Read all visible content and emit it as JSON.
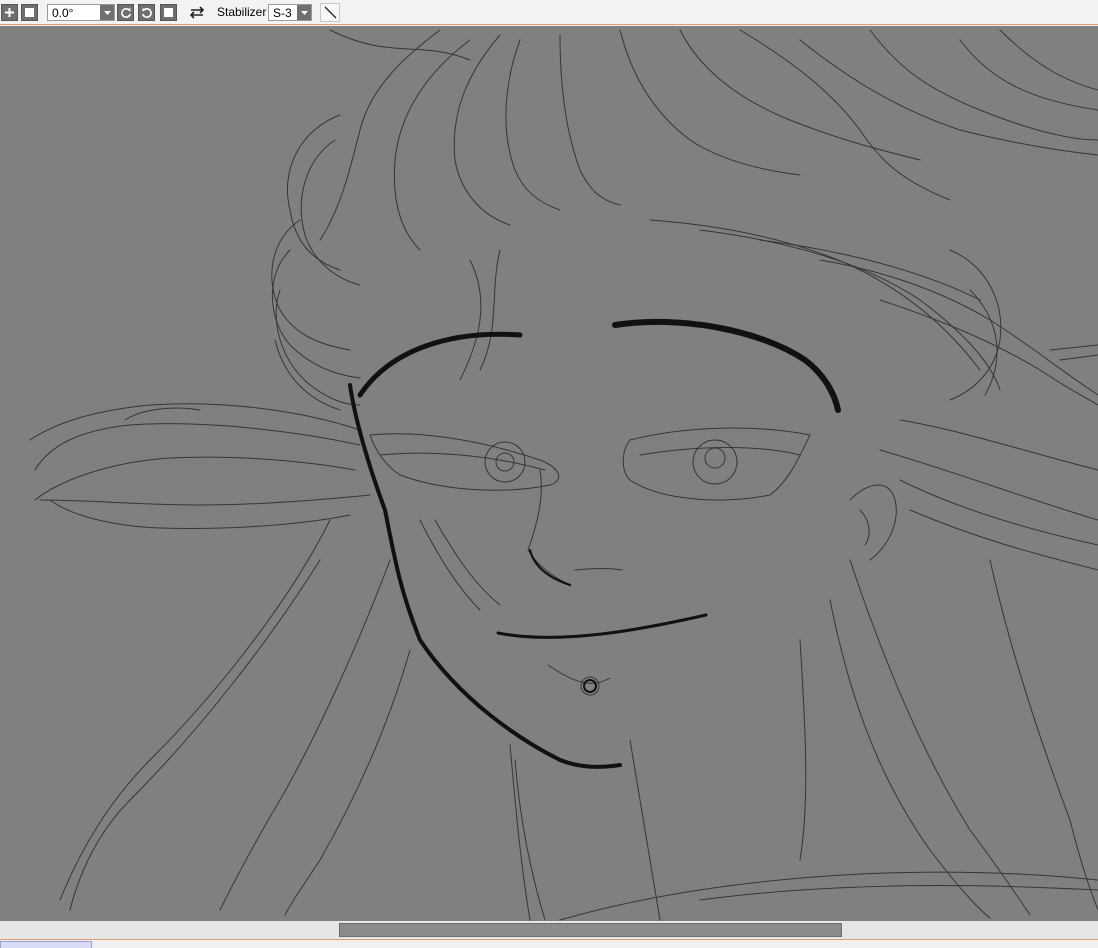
{
  "toolbar": {
    "buttons": [
      {
        "name": "zoom-in-button",
        "icon": "plus-icon"
      },
      {
        "name": "zoom-reset-button",
        "icon": "square-icon"
      }
    ],
    "rotation_value": "0.0°",
    "rotate_buttons": [
      {
        "name": "rotate-ccw-button",
        "icon": "rotate-ccw-icon"
      },
      {
        "name": "rotate-cw-button",
        "icon": "rotate-cw-icon"
      },
      {
        "name": "rotate-reset-button",
        "icon": "square-icon"
      }
    ],
    "flip_icon": "flip-horizontal-icon",
    "stabilizer_label": "Stabilizer",
    "stabilizer_value": "S-3",
    "line_tool_icon": "straight-line-icon"
  },
  "canvas": {
    "background_color": "#808080",
    "stroke_color": "#2a2a2a",
    "content": "pencil sketch of a face with flowing hair"
  },
  "accent_color": "#e59a6e"
}
